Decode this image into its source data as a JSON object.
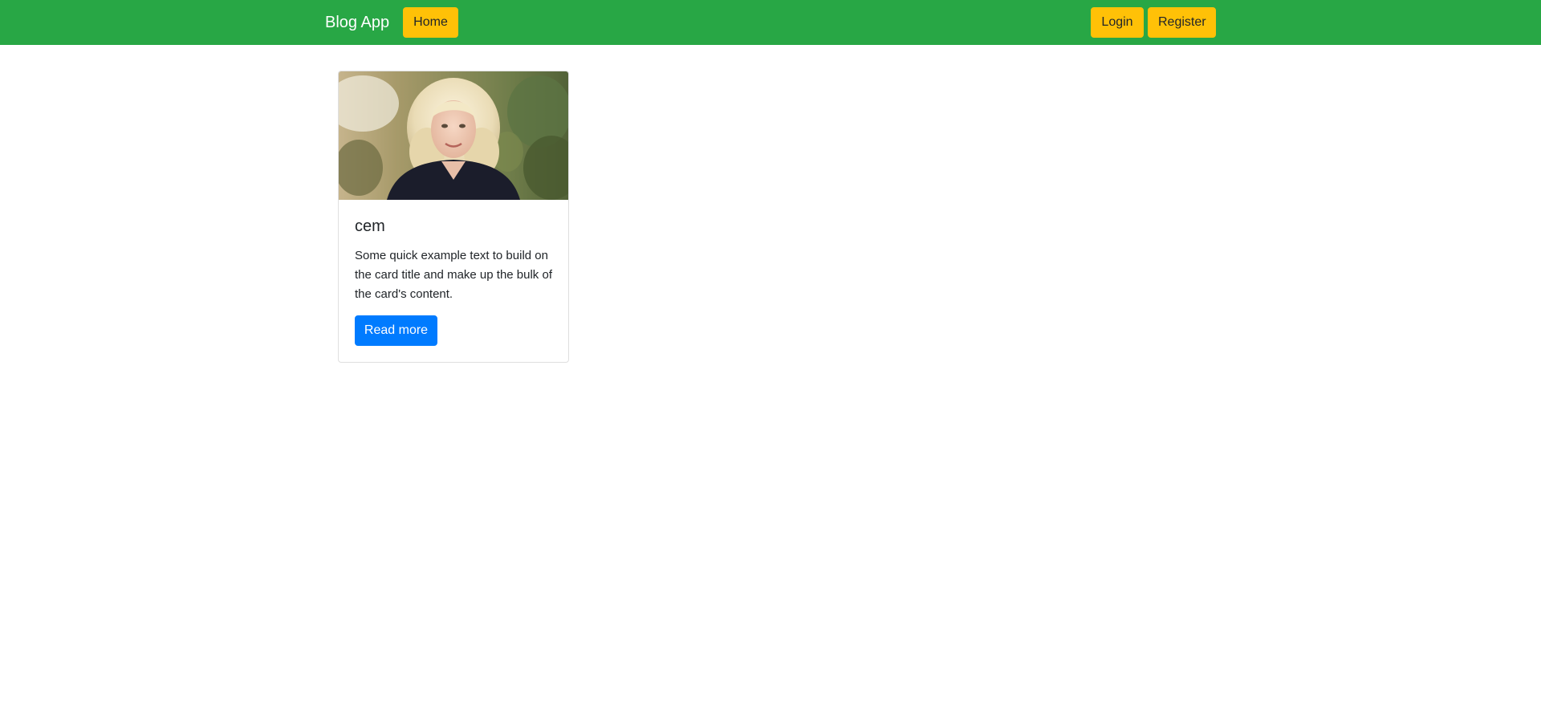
{
  "navbar": {
    "brand": "Blog App",
    "home_label": "Home",
    "login_label": "Login",
    "register_label": "Register",
    "background_color": "#28a745",
    "button_color": "#ffc107"
  },
  "posts": [
    {
      "image": "portrait-photo",
      "title": "cem",
      "text": "Some quick example text to build on the card title and make up the bulk of the card's content.",
      "read_more_label": "Read more",
      "button_color": "#007bff"
    }
  ]
}
